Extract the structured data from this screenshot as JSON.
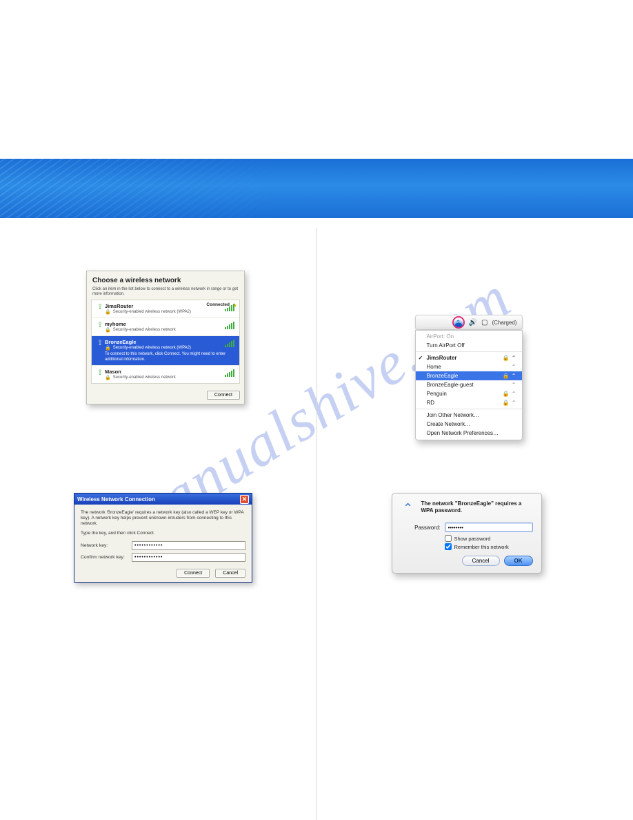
{
  "watermark": "manualshive.com",
  "xp_window": {
    "title": "Choose a wireless network",
    "subtitle": "Click an item in the list below to connect to a wireless network in range or to get more information.",
    "networks": [
      {
        "name": "JimsRouter",
        "sec": "Security-enabled wireless network (WPA2)",
        "connected_label": "Connected",
        "starred": true
      },
      {
        "name": "myhome",
        "sec": "Security-enabled wireless network"
      },
      {
        "name": "BronzeEagle",
        "sec": "Security-enabled wireless network (WPA2)",
        "hint": "To connect to this network, click Connect. You might need to enter additional information.",
        "selected": true
      },
      {
        "name": "Mason",
        "sec": "Security-enabled wireless network"
      }
    ],
    "connect": "Connect"
  },
  "xp_dialog": {
    "title": "Wireless Network Connection",
    "msg1": "The network 'BronzeEagle' requires a network key (also called a WEP key or WPA key). A network key helps prevent unknown intruders from connecting to this network.",
    "msg2": "Type the key, and then click Connect.",
    "key_label": "Network key:",
    "confirm_label": "Confirm network key:",
    "key_value": "••••••••••••",
    "confirm_value": "••••••••••••",
    "connect": "Connect",
    "cancel": "Cancel"
  },
  "mac_menubar": {
    "battery": "(Charged)"
  },
  "mac_menu": {
    "status": "AirPort: On",
    "toggle": "Turn AirPort Off",
    "items": [
      {
        "label": "JimsRouter",
        "checked": true,
        "locked": true
      },
      {
        "label": "Home"
      },
      {
        "label": "BronzeEagle",
        "selected": true,
        "locked": true
      },
      {
        "label": "BronzeEagle-guest"
      },
      {
        "label": "Penguin",
        "locked": true
      },
      {
        "label": "RD",
        "locked": true
      }
    ],
    "join": "Join Other Network…",
    "create": "Create Network…",
    "prefs": "Open Network Preferences…"
  },
  "mac_dialog": {
    "msg": "The network \"BronzeEagle\" requires a WPA password.",
    "pwd_label": "Password:",
    "pwd_value": "••••••••",
    "show_label": "Show password",
    "remember_label": "Remember this network",
    "cancel": "Cancel",
    "ok": "OK"
  }
}
